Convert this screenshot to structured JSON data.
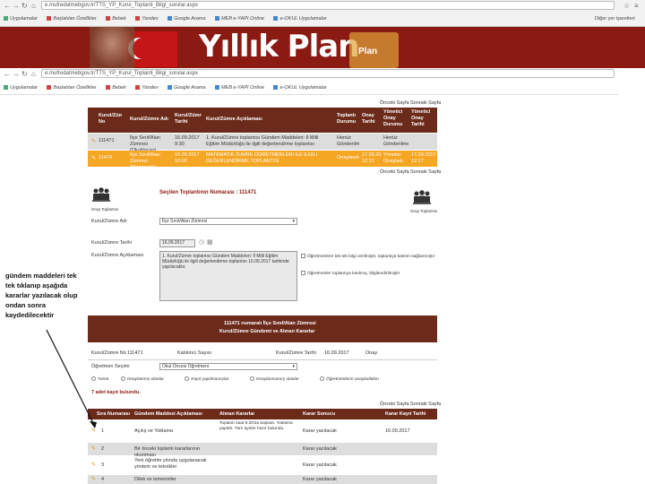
{
  "browser_back": {
    "url": "e.mufredatmebgov.tr/TTS_YP_Kurul_Toplanti_Bilgi_sorular.aspx",
    "bookmarks": [
      "Uygulamalar",
      "Başlatılan Özellikler",
      "Bebek",
      "Yandex",
      "Google Arama",
      "MEB e-YAPI Online",
      "e-OKUL Uygulamalar"
    ],
    "other_bookmarks": "Diğer yer işaretleri"
  },
  "banner": {
    "title": "Yıllık Plan",
    "folder_label": "Plan"
  },
  "browser_front": {
    "url": "e.mufredatmebgov.tr/TTS_YP_Kurul_Toplanti_Bilgi_sorular.aspx",
    "bookmarks": [
      "Uygulamalar",
      "Başlatılan Özellikler",
      "Bebek",
      "Yandex",
      "Google Arama",
      "MEB e-YAPI Online",
      "e-OKUL Uygulamalar"
    ]
  },
  "top_links": {
    "prev": "Önceki Sayfa",
    "next": "Sonraki Sayfa"
  },
  "meetings_table": {
    "headers": [
      "Kurul/Zümre No",
      "Kurul/Zümre Adı",
      "Kurul/Zümre Tarihi",
      "Kurul/Zümre Açıklaması",
      "Toplantı Durumu",
      "Onay Tarihi",
      "Yönetici Onay Durumu",
      "Yönetici Onay Tarihi"
    ],
    "rows": [
      [
        "111471",
        "İlçe Sınıf/Alan Zümresi (Okulöncesi Matematik)",
        "16.09.2017 9:30",
        "1. Kurul/Zümre toplantısı Gündem Maddeleri: İl Milli Eğitim Müdürlüğü ile ilgili değerlendirme toplantısı",
        "Henüz Gönderilmedi",
        "",
        "Henüz Gönderilmedi",
        ""
      ],
      [
        "11470",
        "İlçe Sınıf/Alan Zümresi (Matematik)",
        "16.09.2017 10:00",
        "MATEMATİK ZÜMRE ÖĞRETMENLERİ İLE İLGİLİ DEĞERLENDİRME TOPLANTISI",
        "Onaylandı",
        "17.09.2017 12:17",
        "Yönetici Onayladı",
        "17.09.2017 12:17"
      ]
    ]
  },
  "mid_links": {
    "prev": "Önceki Sayfa",
    "next": "Sonraki Sayfa"
  },
  "meeting_form": {
    "title": "Seçilen Toplantının Numarası : 111471",
    "left_icon_caption": "Grup Toplantısı",
    "right_icon_caption": "Grup Toplantısı",
    "type_label": "Kurul/Zümre Adı",
    "type_value": "İlçe Sınıf/Alan Zümresi",
    "date_label": "Kurul/Zümre Tarihi",
    "date_value": "16.09.2017",
    "desc_label": "Kurul/Zümre Açıklaması",
    "desc_value": "1. Kurul/Zümre toplantısı Gündem Maddeleri: İl Milli Eğitim Müdürlüğü ile ilgili değerlendirme toplantısı 16.09.2017 tarihinde yapılacaktır.",
    "check1": "Öğretmenlere tek tek bilgi verilmiştir, toplantıya katılım sağlanmıştır",
    "check2": "Öğretmenler toplantıya katılmış, bilgilendirilmiştir"
  },
  "agenda_header": {
    "line1": "111471 numaralı İlçe Sınıf/Alan Zümresi",
    "line2": "Kurul/Zümre Gündemi ve Alınan Kararlar"
  },
  "filters": {
    "f1_label": "Kurul/Zümre No",
    "f1_value": "111471",
    "f2_label": "Katılımcı Sayısı",
    "f2_value": "",
    "f3_label": "Kurul/Zümre Tarihi",
    "f3_value": "16.09.2017",
    "f4_label": "Onay",
    "f4_value": "",
    "select_label": "Öğretmen Seçimi",
    "select_value": "Okul Öncesi Öğretmeni",
    "radios": [
      "Tümü",
      "Onaylanmış olanlar",
      "Kayıt yapılmamışlar",
      "Onaylanmamış olanlar",
      "Öğretmenlerin onayladıkları"
    ]
  },
  "records_found": "7 adet kayıt bulundu.",
  "bottom_links": {
    "prev": "Önceki Sayfa",
    "next": "Sonraki Sayfa"
  },
  "agenda_table": {
    "headers": [
      "Sıra Numarası",
      "Gündem Maddesi Açıklaması",
      "Alınan Kararlar",
      "Karar Sonucu",
      "Karar Kayıt Tarihi"
    ],
    "rows": [
      [
        "1",
        "Açılış ve Yoklama",
        "Toplantı saat 9:30'da başladı. Yoklama yapıldı. Tüm üyeler hazır bulundu.",
        "Karar yazılacak",
        "16.09.2017"
      ],
      [
        "2",
        "Bir önceki toplantı kararlarının okunması",
        "",
        "Karar yazılacak",
        ""
      ],
      [
        "3",
        "Yeni öğretim yılında uygulanacak yöntem ve teknikler",
        "",
        "Karar yazılacak",
        ""
      ],
      [
        "4",
        "Dilek ve temenniler",
        "",
        "Karar yazılacak",
        ""
      ]
    ]
  },
  "annotation": "gündem maddeleri tek tek tıklanıp aşağıda kararlar yazılacak olup ondan sonra kaydedilecektir"
}
